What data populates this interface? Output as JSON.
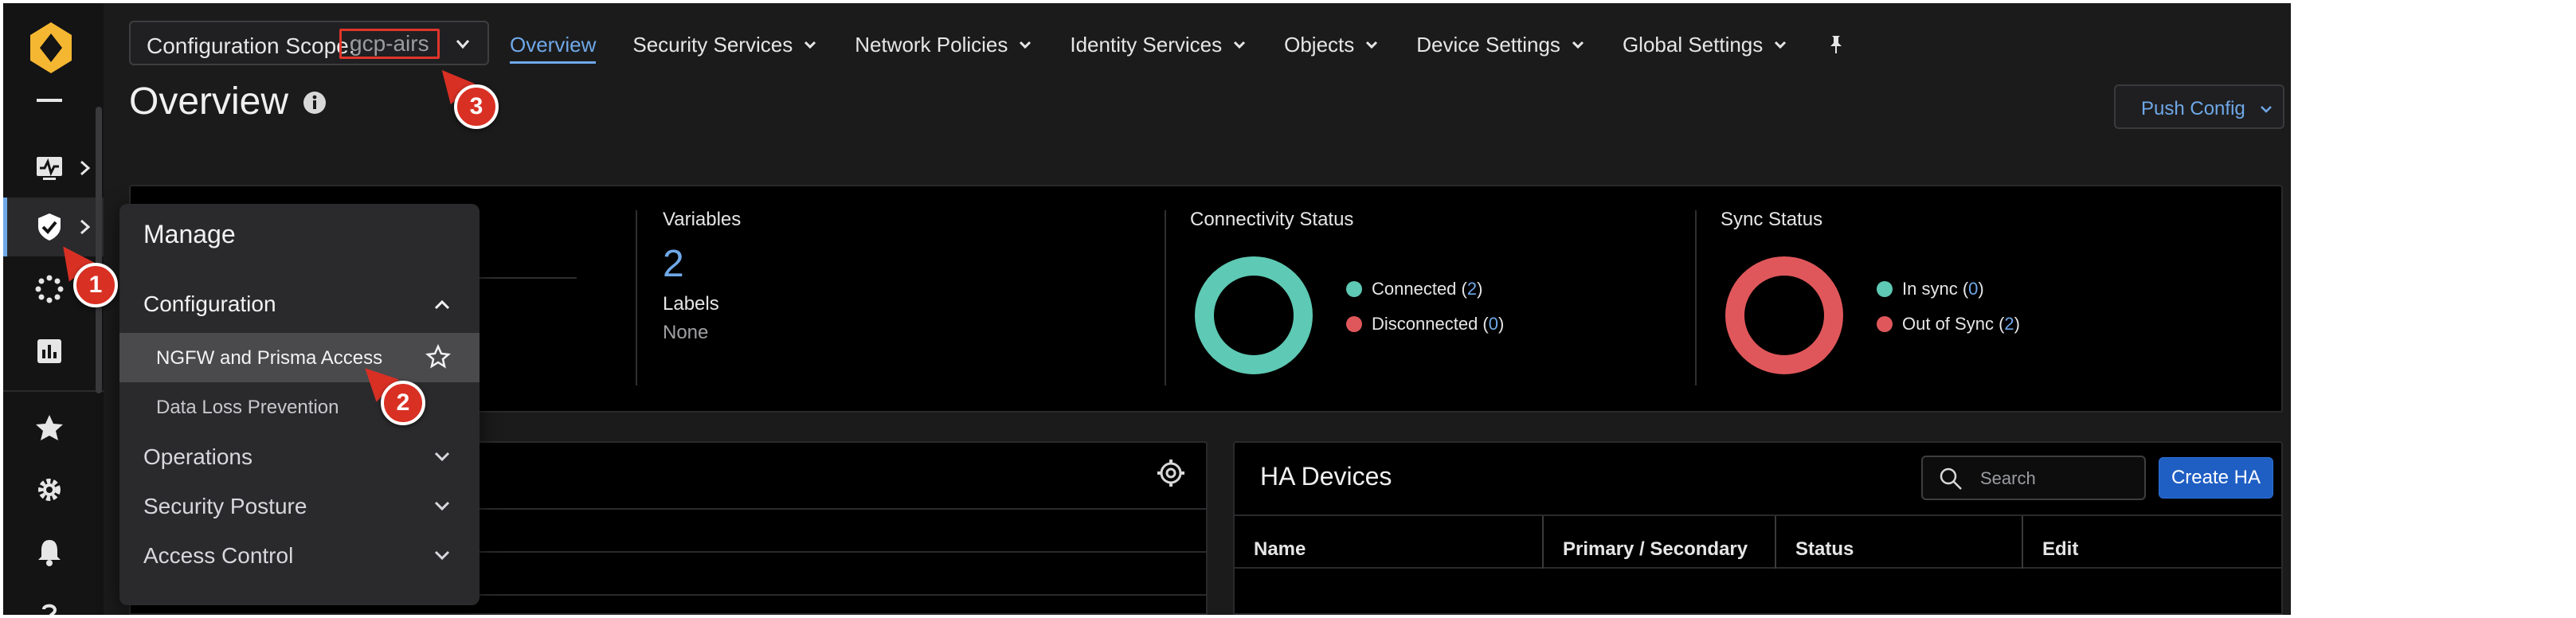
{
  "topbar": {
    "scope_label": "Configuration Scope:",
    "scope_value": "gcp-airs",
    "nav": [
      {
        "label": "Overview",
        "active": true
      },
      {
        "label": "Security Services"
      },
      {
        "label": "Network Policies"
      },
      {
        "label": "Identity Services"
      },
      {
        "label": "Objects"
      },
      {
        "label": "Device Settings"
      },
      {
        "label": "Global Settings"
      }
    ],
    "pin_icon": "pin-icon"
  },
  "page": {
    "title": "Overview",
    "info_icon": "info-icon",
    "push_config_label": "Push Config"
  },
  "summary": {
    "variables_title": "Variables",
    "variables_count": "2",
    "labels_title": "Labels",
    "labels_value": "None",
    "connectivity": {
      "title": "Connectivity Status",
      "legend": [
        {
          "label": "Connected",
          "count": "2",
          "color": "#5ec9b4"
        },
        {
          "label": "Disconnected",
          "count": "0",
          "color": "#e0575b"
        }
      ],
      "ring_color": "#5ec9b4"
    },
    "sync": {
      "title": "Sync Status",
      "legend": [
        {
          "label": "In sync",
          "count": "0",
          "color": "#5ec9b4"
        },
        {
          "label": "Out of Sync",
          "count": "2",
          "color": "#e0575b"
        }
      ],
      "ring_color": "#e0575b"
    }
  },
  "ha_devices": {
    "title": "HA Devices",
    "search_placeholder": "Search",
    "create_label": "Create HA",
    "columns": [
      "Name",
      "Primary / Secondary",
      "Status",
      "Edit"
    ]
  },
  "flyout": {
    "title": "Manage",
    "section": "Configuration",
    "items": [
      {
        "label": "NGFW and Prisma Access",
        "selected": true
      },
      {
        "label": "Data Loss Prevention"
      }
    ],
    "groups": [
      "Operations",
      "Security Posture",
      "Access Control"
    ]
  },
  "callouts": [
    "1",
    "2",
    "3"
  ],
  "colors": {
    "accent": "#6fa8e8",
    "logo": "#f5b731",
    "highlight": "#e0352b",
    "create_button": "#1f5fc4"
  }
}
